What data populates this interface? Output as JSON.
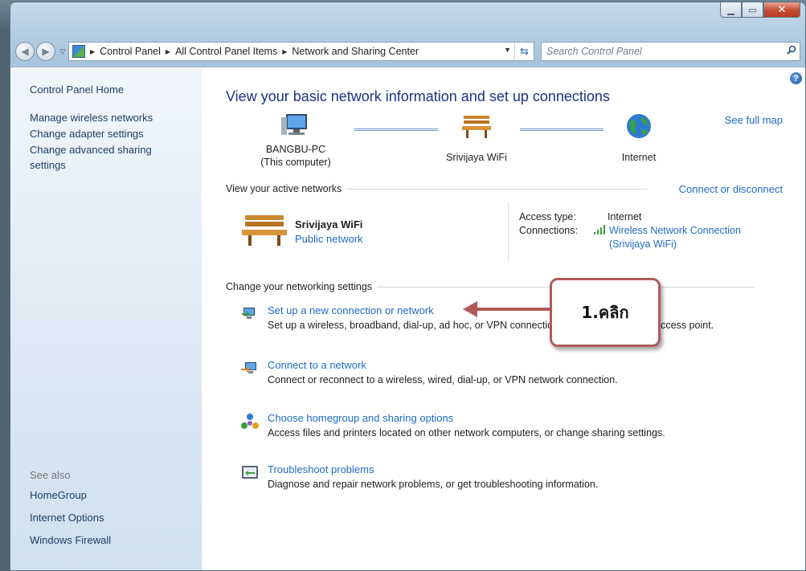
{
  "address_bar": {
    "crumbs": [
      "Control Panel",
      "All Control Panel Items",
      "Network and Sharing Center"
    ]
  },
  "search": {
    "placeholder": "Search Control Panel"
  },
  "sidebar": {
    "home": "Control Panel Home",
    "links": [
      "Manage wireless networks",
      "Change adapter settings",
      "Change advanced sharing settings"
    ],
    "see_also_title": "See also",
    "see_also": [
      "HomeGroup",
      "Internet Options",
      "Windows Firewall"
    ]
  },
  "main": {
    "title": "View your basic network information and set up connections",
    "see_full_map": "See full map",
    "map": {
      "computer_name": "BANGBU-PC",
      "computer_sub": "(This computer)",
      "network_name": "Srivijaya WiFi",
      "internet": "Internet"
    },
    "active_header": "View your active networks",
    "connect_or_disconnect": "Connect or disconnect",
    "active_network": {
      "name": "Srivijaya WiFi",
      "type": "Public network",
      "access_type_label": "Access type:",
      "access_type_value": "Internet",
      "connections_label": "Connections:",
      "connection_value_line1": "Wireless Network Connection",
      "connection_value_line2": "(Srivijaya WiFi)"
    },
    "settings_header": "Change your networking settings",
    "tasks": [
      {
        "title": "Set up a new connection or network",
        "desc": "Set up a wireless, broadband, dial-up, ad hoc, or VPN connection; or set up a router or access point."
      },
      {
        "title": "Connect to a network",
        "desc": "Connect or reconnect to a wireless, wired, dial-up, or VPN network connection."
      },
      {
        "title": "Choose homegroup and sharing options",
        "desc": "Access files and printers located on other network computers, or change sharing settings."
      },
      {
        "title": "Troubleshoot problems",
        "desc": "Diagnose and repair network problems, or get troubleshooting information."
      }
    ]
  },
  "annotation": {
    "label": "1.คลิก"
  },
  "colors": {
    "link": "#1f6ac7",
    "title": "#1e3287",
    "callout_border": "#b05a5a"
  }
}
